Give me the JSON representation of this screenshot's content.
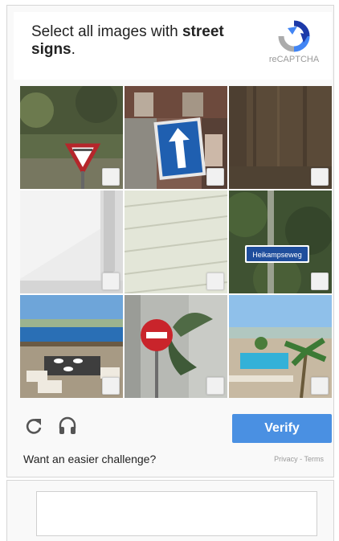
{
  "challenge": {
    "prompt_prefix": "Select all images with ",
    "prompt_target": "street signs",
    "prompt_suffix": "."
  },
  "logo": {
    "label": "reCAPTCHA",
    "icon": "recaptcha-logo-icon"
  },
  "tiles": [
    {
      "subject": "yield-sign",
      "selected": false
    },
    {
      "subject": "one-way-arrow-sign",
      "selected": false
    },
    {
      "subject": "wooden-wall",
      "selected": false
    },
    {
      "subject": "white-wall",
      "selected": false
    },
    {
      "subject": "siding-wall",
      "selected": false
    },
    {
      "subject": "street-name-sign",
      "text": "Heikampseweg",
      "selected": false
    },
    {
      "subject": "patio-sea-view",
      "selected": false
    },
    {
      "subject": "no-entry-sign",
      "selected": false
    },
    {
      "subject": "pool-palm-trees",
      "selected": false
    }
  ],
  "controls": {
    "reload_icon": "reload-icon",
    "audio_icon": "headphones-icon",
    "verify_label": "Verify"
  },
  "footer": {
    "easier_text": "Want an easier challenge?",
    "privacy_label": "Privacy",
    "separator": " - ",
    "terms_label": "Terms"
  },
  "colors": {
    "accent": "#4a90e2"
  }
}
